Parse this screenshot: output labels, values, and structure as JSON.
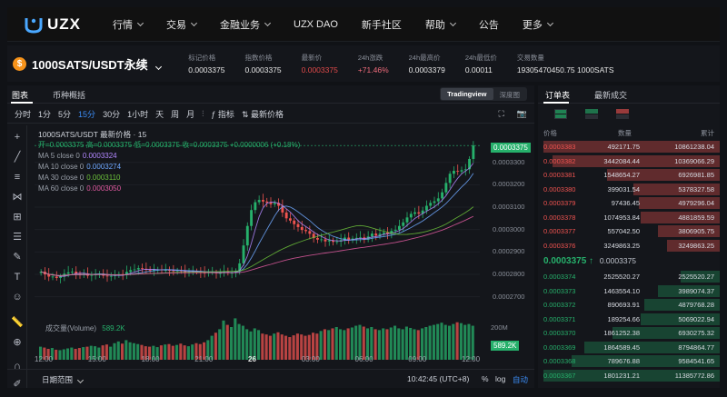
{
  "brand": {
    "name": "UZX"
  },
  "nav": {
    "items": [
      {
        "label": "行情",
        "caret": true
      },
      {
        "label": "交易",
        "caret": true
      },
      {
        "label": "金融业务",
        "caret": true
      },
      {
        "label": "UZX DAO",
        "caret": false
      },
      {
        "label": "新手社区",
        "caret": false
      },
      {
        "label": "帮助",
        "caret": true
      },
      {
        "label": "公告",
        "caret": false
      },
      {
        "label": "更多",
        "caret": true
      }
    ]
  },
  "ticker": {
    "coin_symbol": "$",
    "pair": "1000SATS/USDT永续",
    "stats": [
      {
        "label": "标记价格",
        "value": "0.0003375",
        "tone": "normal"
      },
      {
        "label": "指数价格",
        "value": "0.0003375",
        "tone": "normal"
      },
      {
        "label": "最新价",
        "value": "0.0003375",
        "tone": "red"
      },
      {
        "label": "24h涨跌",
        "value": "+71.46%",
        "tone": "pink"
      },
      {
        "label": "24h最高价",
        "value": "0.0003379",
        "tone": "normal"
      },
      {
        "label": "24h最低价",
        "value": "0.00011",
        "tone": "normal"
      },
      {
        "label": "交易数量",
        "value": "19305470450.75 1000SATS",
        "tone": "normal"
      }
    ]
  },
  "chart_panel": {
    "tabs": [
      "图表",
      "币种概括"
    ],
    "view_modes": [
      "Tradingview",
      "深度图"
    ],
    "toolbar": {
      "intervals": [
        "分时",
        "1分",
        "5分",
        "15分",
        "30分",
        "1小时",
        "天",
        "周",
        "月"
      ],
      "active": "15分",
      "indicator_label": "指标",
      "latest_price_label": "最新价格"
    },
    "legend": {
      "title": "1000SATS/USDT 最新价格 · 15",
      "ohlc": "开=0.0003375 高=0.0003375 低=0.0003375 收=0.0003375 +0.0000006 (+0.18%)",
      "ma": [
        {
          "label": "MA 5 close 0",
          "value": "0.0003324",
          "color": "#b287ff"
        },
        {
          "label": "MA 10 close 0",
          "value": "0.0003274",
          "color": "#6fa8ff"
        },
        {
          "label": "MA 30 close 0",
          "value": "0.0003110",
          "color": "#6cc23a"
        },
        {
          "label": "MA 60 close 0",
          "value": "0.0003050",
          "color": "#e05aa0"
        }
      ]
    },
    "volume_label": "成交量(Volume)",
    "volume_value": "589.2K",
    "bottom": {
      "range_label": "日期范围",
      "time": "10:42:45 (UTC+8)",
      "percent": "%",
      "log": "log",
      "auto": "自动"
    }
  },
  "chart_data": {
    "type": "candlestick",
    "x_labels": [
      "12:00",
      "15:00",
      "18:00",
      "21:00",
      "26",
      "03:00",
      "06:00",
      "09:00",
      "12:00"
    ],
    "y_ticks": [
      "0.0003300",
      "0.0003200",
      "0.0003100",
      "0.0003000",
      "0.0002900",
      "0.0002800",
      "0.0002700"
    ],
    "y_range": [
      0.000265,
      0.00034
    ],
    "last_price_label": "0.0003375",
    "volume_axis_label": "200M",
    "up_color": "#26b06b",
    "down_color": "#ef5350",
    "close": [
      2.812,
      2.8,
      2.79,
      2.79,
      2.784,
      2.79,
      2.803,
      2.809,
      2.812,
      2.803,
      2.8,
      2.803,
      2.794,
      2.797,
      2.8,
      2.803,
      2.794,
      2.791,
      2.793,
      2.796,
      2.801,
      2.799,
      2.811,
      2.819,
      2.822,
      2.828,
      2.825,
      2.82,
      2.817,
      2.822,
      2.822,
      2.819,
      2.819,
      2.817,
      2.815,
      2.817,
      2.815,
      2.81,
      2.812,
      2.814,
      2.812,
      2.808,
      2.806,
      2.809,
      2.809,
      2.805,
      2.806,
      2.814,
      2.807,
      2.807,
      2.815,
      2.849,
      2.929,
      3.016,
      3.087,
      3.122,
      3.132,
      3.125,
      3.12,
      3.113,
      3.119,
      3.106,
      3.076,
      3.05,
      3.04,
      3.024,
      3.011,
      2.998,
      2.993,
      2.981,
      2.962,
      2.955,
      2.956,
      2.947,
      2.952,
      2.945,
      2.947,
      2.953,
      2.964,
      2.952,
      2.96,
      2.963,
      2.965,
      2.955,
      2.969,
      2.982,
      2.973,
      2.981,
      2.987,
      2.981,
      2.994,
      2.999,
      3.016,
      3.032,
      3.054,
      3.07,
      3.077,
      3.071,
      3.085,
      3.106,
      3.119,
      3.126,
      3.139,
      3.166,
      3.208,
      3.249,
      3.262,
      3.259,
      3.265,
      3.269,
      3.315,
      3.375
    ],
    "volume": [
      0.3,
      0.28,
      0.25,
      0.27,
      0.23,
      0.22,
      0.24,
      0.26,
      0.28,
      0.25,
      0.27,
      0.29,
      0.3,
      0.32,
      0.31,
      0.28,
      0.33,
      0.35,
      0.3,
      0.38,
      0.42,
      0.37,
      0.45,
      0.4,
      0.38,
      0.36,
      0.34,
      0.31,
      0.3,
      0.32,
      0.29,
      0.33,
      0.35,
      0.36,
      0.32,
      0.34,
      0.37,
      0.33,
      0.31,
      0.35,
      0.38,
      0.36,
      0.4,
      0.45,
      0.55,
      0.62,
      0.7,
      0.9,
      0.8,
      0.75,
      0.95,
      0.82,
      0.78,
      0.7,
      0.65,
      0.72,
      0.68,
      0.6,
      0.58,
      0.55,
      0.6,
      0.63,
      0.58,
      0.55,
      0.52,
      0.56,
      0.6,
      0.58,
      0.55,
      0.57,
      0.62,
      0.6,
      0.66,
      0.7,
      0.68,
      0.72,
      0.75,
      0.7,
      0.68,
      0.72,
      0.74,
      0.78,
      0.8,
      0.76,
      0.72,
      0.75,
      0.7,
      0.68,
      0.72,
      0.7,
      0.74,
      0.78,
      0.72,
      0.7,
      0.76,
      0.73,
      0.7,
      0.68,
      0.72,
      0.75,
      0.78,
      0.8,
      0.82,
      0.85,
      0.8,
      0.78,
      0.82,
      0.86,
      0.84,
      0.8,
      0.82,
      0.78
    ]
  },
  "orderbook": {
    "tabs": [
      "订单表",
      "最新成交"
    ],
    "headers": [
      "价格",
      "数量",
      "累计"
    ],
    "asks": [
      {
        "price": "0.0003383",
        "qty": "492171.75",
        "total": "10861238.04",
        "depth": 1.0
      },
      {
        "price": "0.0003382",
        "qty": "3442084.44",
        "total": "10369066.29",
        "depth": 0.95
      },
      {
        "price": "0.0003381",
        "qty": "1548654.27",
        "total": "6926981.85",
        "depth": 0.64
      },
      {
        "price": "0.0003380",
        "qty": "399031.54",
        "total": "5378327.58",
        "depth": 0.49
      },
      {
        "price": "0.0003379",
        "qty": "97436.45",
        "total": "4979296.04",
        "depth": 0.46
      },
      {
        "price": "0.0003378",
        "qty": "1074953.84",
        "total": "4881859.59",
        "depth": 0.45
      },
      {
        "price": "0.0003377",
        "qty": "557042.50",
        "total": "3806905.75",
        "depth": 0.35
      },
      {
        "price": "0.0003376",
        "qty": "3249863.25",
        "total": "3249863.25",
        "depth": 0.3
      }
    ],
    "mid": {
      "price": "0.0003375 ↑",
      "ref": "0.0003375"
    },
    "bids": [
      {
        "price": "0.0003374",
        "qty": "2525520.27",
        "total": "2525520.27",
        "depth": 0.22
      },
      {
        "price": "0.0003373",
        "qty": "1463554.10",
        "total": "3989074.37",
        "depth": 0.35
      },
      {
        "price": "0.0003372",
        "qty": "890693.91",
        "total": "4879768.28",
        "depth": 0.43
      },
      {
        "price": "0.0003371",
        "qty": "189254.66",
        "total": "5069022.94",
        "depth": 0.45
      },
      {
        "price": "0.0003370",
        "qty": "1861252.38",
        "total": "6930275.32",
        "depth": 0.61
      },
      {
        "price": "0.0003369",
        "qty": "1864589.45",
        "total": "8794864.77",
        "depth": 0.77
      },
      {
        "price": "0.0003368",
        "qty": "789676.88",
        "total": "9584541.65",
        "depth": 0.84
      },
      {
        "price": "0.0003367",
        "qty": "1801231.21",
        "total": "11385772.86",
        "depth": 1.0
      }
    ]
  }
}
